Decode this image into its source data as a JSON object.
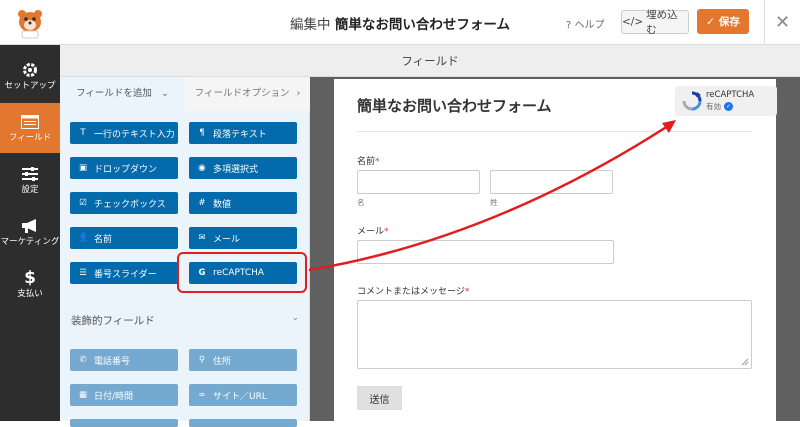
{
  "header": {
    "title_prefix": "編集中",
    "title_form": "簡単なお問い合わせフォーム",
    "help_label": "ヘルプ",
    "embed_label": "埋め込む",
    "save_label": "保存"
  },
  "sidebar": {
    "items": [
      {
        "label": "セットアップ",
        "icon": "gear-icon"
      },
      {
        "label": "フィールド",
        "icon": "fields-list-icon"
      },
      {
        "label": "設定",
        "icon": "sliders-icon"
      },
      {
        "label": "マーケティング",
        "icon": "megaphone-icon"
      },
      {
        "label": "支払い",
        "icon": "dollar-icon"
      }
    ]
  },
  "field_bar": {
    "title": "フィールド"
  },
  "panel": {
    "tabs": {
      "add": "フィールドを追加",
      "options": "フィールドオプション"
    },
    "standard_fields": [
      {
        "label": "一行のテキスト入力",
        "icon": "text-icon"
      },
      {
        "label": "段落テキスト",
        "icon": "paragraph-icon"
      },
      {
        "label": "ドロップダウン",
        "icon": "dropdown-icon"
      },
      {
        "label": "多項選択式",
        "icon": "radio-icon"
      },
      {
        "label": "チェックボックス",
        "icon": "checkbox-icon"
      },
      {
        "label": "数値",
        "icon": "hash-icon"
      },
      {
        "label": "名前",
        "icon": "user-icon"
      },
      {
        "label": "メール",
        "icon": "envelope-icon"
      },
      {
        "label": "番号スライダー",
        "icon": "slider-icon"
      },
      {
        "label": "reCAPTCHA",
        "icon": "google-icon"
      }
    ],
    "fancy_section_label": "装飾的フィールド",
    "fancy_fields": [
      {
        "label": "電話番号",
        "icon": "phone-icon"
      },
      {
        "label": "住所",
        "icon": "map-pin-icon"
      },
      {
        "label": "日付/時間",
        "icon": "calendar-icon"
      },
      {
        "label": "サイト／URL",
        "icon": "link-icon"
      }
    ]
  },
  "form": {
    "title": "簡単なお問い合わせフォーム",
    "name_label": "名前",
    "first_sub": "名",
    "last_sub": "姓",
    "email_label": "メール",
    "message_label": "コメントまたはメッセージ",
    "required_mark": "*",
    "submit_label": "送信"
  },
  "recaptcha_badge": {
    "title": "reCAPTCHA",
    "status": "有効"
  },
  "colors": {
    "accent": "#e27730",
    "field_button": "#036aab",
    "highlight": "#e21d1d",
    "sidebar_bg": "#2d2d2d"
  }
}
